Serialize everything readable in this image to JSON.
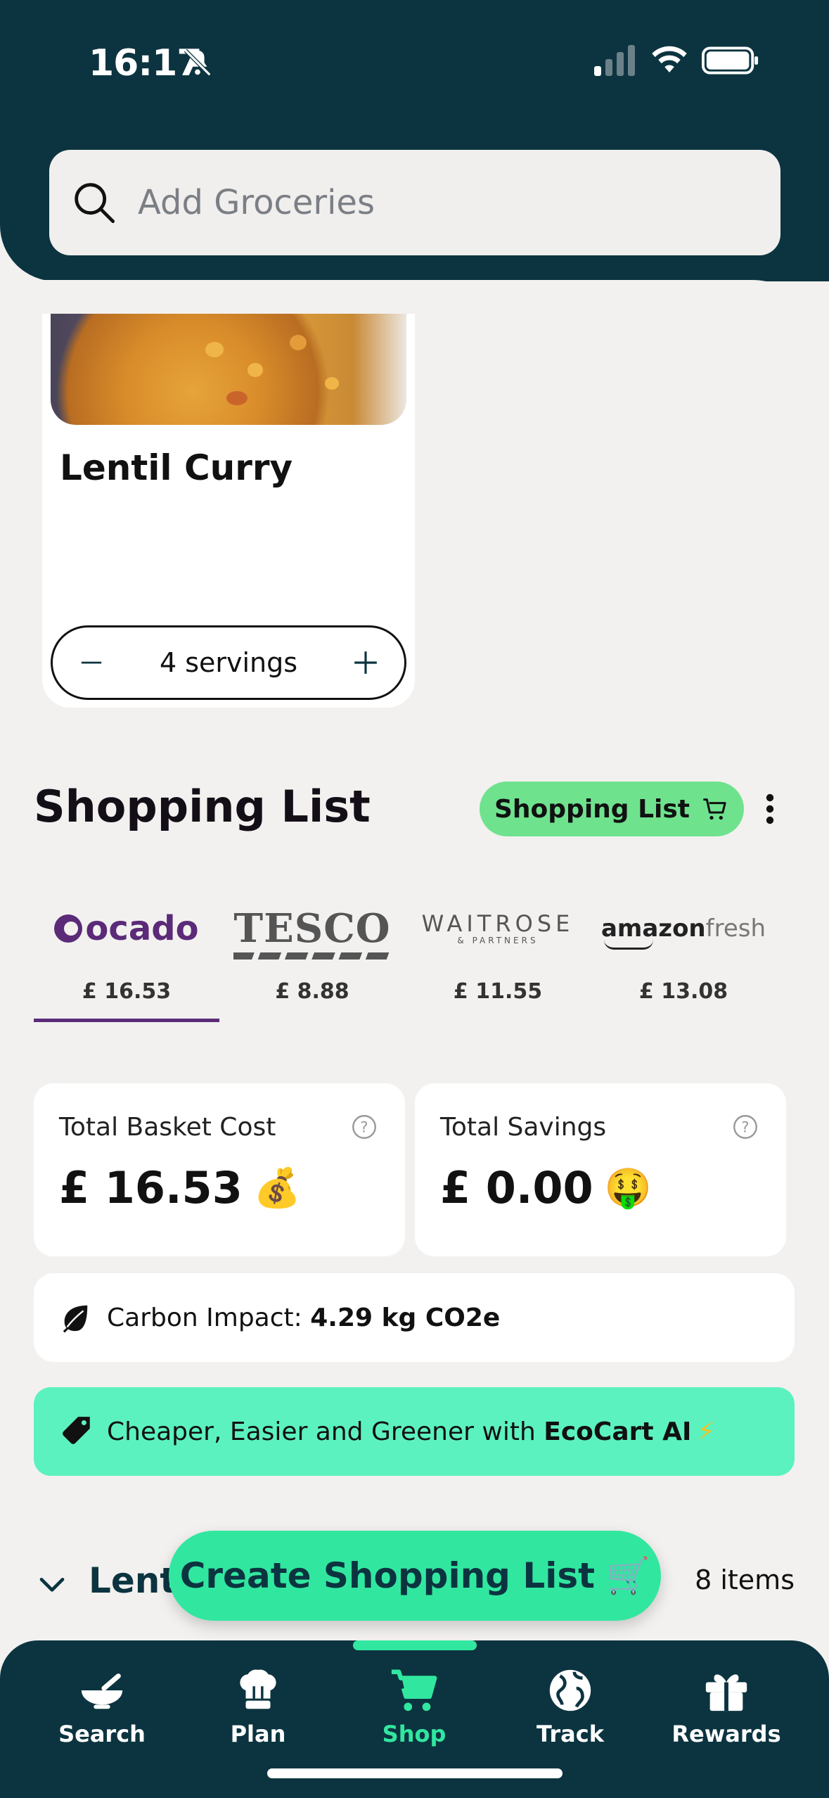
{
  "status": {
    "time": "16:17"
  },
  "search": {
    "placeholder": "Add Groceries"
  },
  "recipe": {
    "title": "Lentil Curry",
    "servings_label": "4 servings"
  },
  "shopping_list": {
    "title": "Shopping List",
    "pill_label": "Shopping List",
    "retailers": [
      {
        "name": "ocado",
        "price": "£ 16.53",
        "selected": true
      },
      {
        "name": "TESCO",
        "price": "£ 8.88",
        "selected": false
      },
      {
        "name": "WAITROSE",
        "subname": "& PARTNERS",
        "price": "£ 11.55",
        "selected": false
      },
      {
        "name": "amazon",
        "name2": "fresh",
        "price": "£ 13.08",
        "selected": false
      }
    ]
  },
  "basket": {
    "total_cost_title": "Total Basket Cost",
    "total_cost_value": "£ 16.53",
    "total_cost_emoji": "💰",
    "total_savings_title": "Total Savings",
    "total_savings_value": "£ 0.00",
    "total_savings_emoji": "🤑"
  },
  "carbon": {
    "label": "Carbon Impact:",
    "value": "4.29 kg CO2e"
  },
  "eco_banner": {
    "text": "Cheaper, Easier and Greener with",
    "brand": "EcoCart AI",
    "emoji": "⚡"
  },
  "group": {
    "name": "Lenti",
    "count": "8 items"
  },
  "cta": {
    "label": "Create Shopping List",
    "emoji": "🛒"
  },
  "nav": {
    "items": [
      {
        "label": "Search",
        "icon": "bowl-icon"
      },
      {
        "label": "Plan",
        "icon": "chef-hat-icon"
      },
      {
        "label": "Shop",
        "icon": "cart-icon",
        "active": true
      },
      {
        "label": "Track",
        "icon": "globe-icon"
      },
      {
        "label": "Rewards",
        "icon": "gift-icon"
      }
    ]
  },
  "colors": {
    "header": "#0c3440",
    "accent": "#31e7a0",
    "ocado": "#5b2a78",
    "pill": "#6fe28e",
    "eco": "#5cf2bf"
  }
}
